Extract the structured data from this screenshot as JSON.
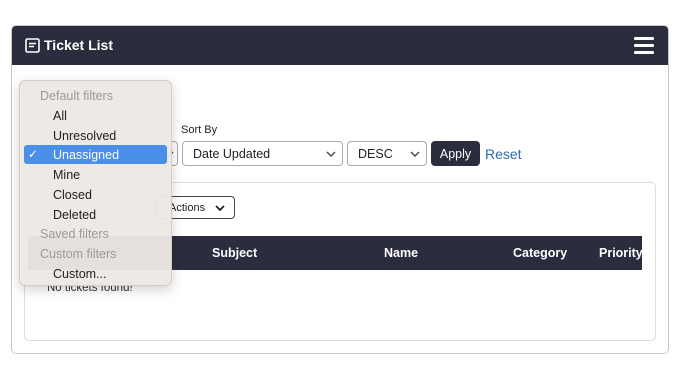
{
  "header": {
    "title": "Ticket List",
    "title_icon": "list-icon",
    "menu_icon": "hamburger-icon"
  },
  "filters": {
    "sort_label": "Sort By",
    "sort_value": "Date Updated",
    "order_value": "DESC",
    "apply_label": "Apply",
    "reset_label": "Reset"
  },
  "dropdown": {
    "groups": [
      {
        "header": "Default filters",
        "items": [
          "All",
          "Unresolved",
          "Unassigned",
          "Mine",
          "Closed",
          "Deleted"
        ]
      },
      {
        "header": "Saved filters",
        "items": []
      },
      {
        "header": "Custom filters",
        "items": [
          "Custom..."
        ]
      }
    ],
    "selected": "Unassigned",
    "selected_color": "#4a8fe8"
  },
  "actions": {
    "label": "Actions"
  },
  "table": {
    "columns": [
      "Subject",
      "Name",
      "Category",
      "Priority"
    ],
    "empty_text": "No tickets found!"
  },
  "colors": {
    "header_bg": "#2b2d3e",
    "link": "#2a6db0"
  }
}
